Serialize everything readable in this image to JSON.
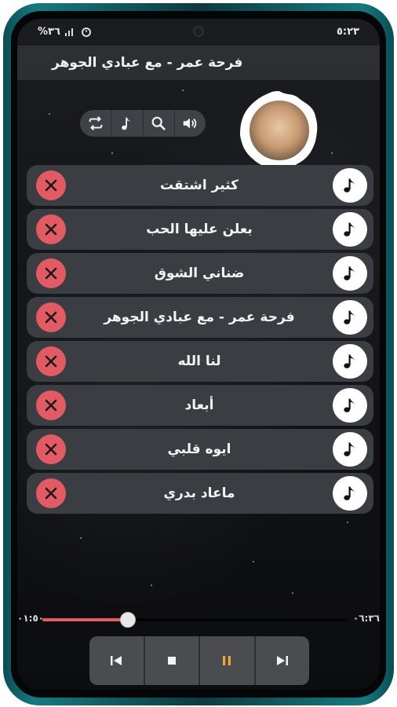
{
  "status_bar": {
    "time": "٥:٢٣",
    "battery": "%٣٦"
  },
  "title": "فرحة عمر - مع عبادي الجوهر",
  "toolbar": {
    "icons": [
      "repeat-icon",
      "music-note-icon",
      "search-icon",
      "volume-icon"
    ]
  },
  "playlist": [
    {
      "title": "كثير اشتقت"
    },
    {
      "title": "بعلن عليها الحب"
    },
    {
      "title": "ضناني الشوق"
    },
    {
      "title": "فرحة عمر - مع عبادي الجوهر"
    },
    {
      "title": "لنا الله"
    },
    {
      "title": "أبعاد"
    },
    {
      "title": "ايوه قلبي"
    },
    {
      "title": "ماعاد بدري"
    }
  ],
  "player": {
    "elapsed": "٠١:٥٠",
    "duration": "٠٦:٣٦",
    "progress": 0.28,
    "buttons": [
      "previous-icon",
      "stop-icon",
      "pause-icon",
      "next-icon"
    ]
  },
  "colors": {
    "accent": "#e35c62",
    "pause": "#f0a72e",
    "row_bg": "#3a3d42"
  }
}
